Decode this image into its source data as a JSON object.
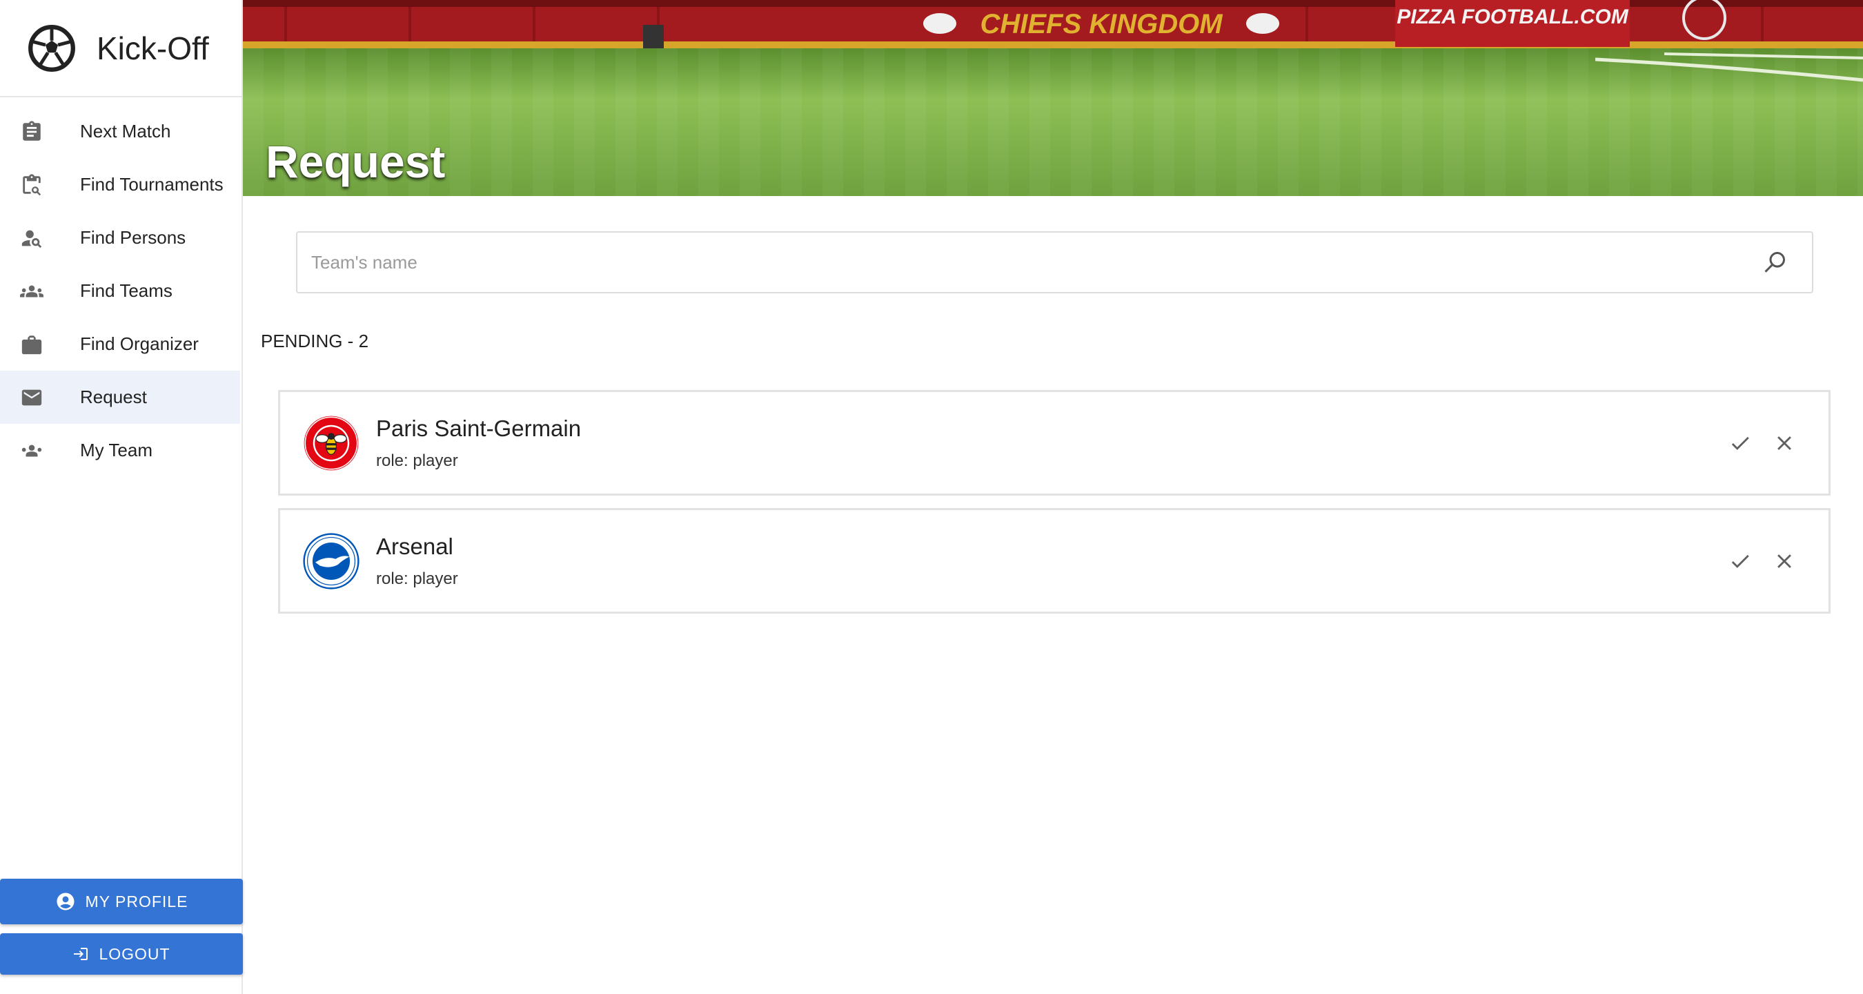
{
  "app": {
    "name": "Kick-Off"
  },
  "sidebar": {
    "items": [
      {
        "label": "Next Match",
        "icon": "clipboard-icon"
      },
      {
        "label": "Find Tournaments",
        "icon": "clipboard-search-icon"
      },
      {
        "label": "Find Persons",
        "icon": "person-search-icon"
      },
      {
        "label": "Find Teams",
        "icon": "groups-icon"
      },
      {
        "label": "Find Organizer",
        "icon": "briefcase-icon"
      },
      {
        "label": "Request",
        "icon": "mail-icon",
        "active": true
      },
      {
        "label": "My Team",
        "icon": "people-icon"
      }
    ],
    "profile_button": "MY PROFILE",
    "logout_button": "LOGOUT"
  },
  "banner": {
    "title": "Request",
    "signage_main": "CHIEFS KINGDOM",
    "signage_right": "PIZZA FOOTBALL.COM"
  },
  "search": {
    "placeholder": "Team's name",
    "value": ""
  },
  "pending": {
    "label": "PENDING - 2",
    "requests": [
      {
        "team": "Paris Saint-Germain",
        "role": "role: player",
        "logo": "brentford-crest-icon"
      },
      {
        "team": "Arsenal",
        "role": "role: player",
        "logo": "brighton-crest-icon"
      }
    ]
  },
  "colors": {
    "primary": "#3474d4",
    "active_nav_bg": "#edf1f9",
    "stadium_red": "#a31a1f",
    "grass": "#7fb547"
  }
}
